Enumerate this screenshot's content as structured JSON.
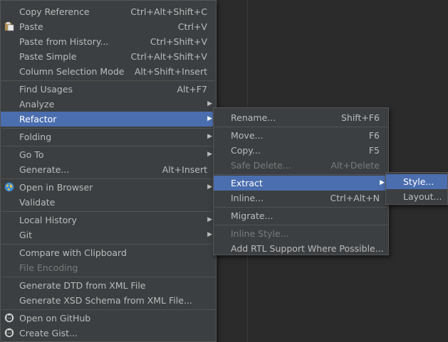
{
  "main_menu": {
    "copy_reference": {
      "label": "Copy Reference",
      "shortcut": "Ctrl+Alt+Shift+C"
    },
    "paste": {
      "label": "Paste",
      "shortcut": "Ctrl+V"
    },
    "paste_from_history": {
      "label": "Paste from History...",
      "shortcut": "Ctrl+Shift+V"
    },
    "paste_simple": {
      "label": "Paste Simple",
      "shortcut": "Ctrl+Alt+Shift+V"
    },
    "column_selection_mode": {
      "label": "Column Selection Mode",
      "shortcut": "Alt+Shift+Insert"
    },
    "find_usages": {
      "label": "Find Usages",
      "shortcut": "Alt+F7"
    },
    "analyze": {
      "label": "Analyze"
    },
    "refactor": {
      "label": "Refactor"
    },
    "folding": {
      "label": "Folding"
    },
    "go_to": {
      "label": "Go To"
    },
    "generate": {
      "label": "Generate...",
      "shortcut": "Alt+Insert"
    },
    "open_in_browser": {
      "label": "Open in Browser"
    },
    "validate": {
      "label": "Validate"
    },
    "local_history": {
      "label": "Local History"
    },
    "git": {
      "label": "Git"
    },
    "compare_with_clipboard": {
      "label": "Compare with Clipboard"
    },
    "file_encoding": {
      "label": "File Encoding"
    },
    "generate_dtd": {
      "label": "Generate DTD from XML File"
    },
    "generate_xsd": {
      "label": "Generate XSD Schema from XML File..."
    },
    "open_on_github": {
      "label": "Open on GitHub"
    },
    "create_gist": {
      "label": "Create Gist..."
    }
  },
  "refactor_menu": {
    "rename": {
      "label": "Rename...",
      "shortcut": "Shift+F6"
    },
    "move": {
      "label": "Move...",
      "shortcut": "F6"
    },
    "copy": {
      "label": "Copy...",
      "shortcut": "F5"
    },
    "safe_delete": {
      "label": "Safe Delete...",
      "shortcut": "Alt+Delete"
    },
    "extract": {
      "label": "Extract"
    },
    "inline": {
      "label": "Inline...",
      "shortcut": "Ctrl+Alt+N"
    },
    "migrate": {
      "label": "Migrate..."
    },
    "inline_style": {
      "label": "Inline Style..."
    },
    "add_rtl": {
      "label": "Add RTL Support Where Possible..."
    }
  },
  "extract_menu": {
    "style": {
      "label": "Style..."
    },
    "layout": {
      "label": "Layout..."
    }
  },
  "colors": {
    "menu_bg": "#3c3f41",
    "selection": "#4b6eaf",
    "text": "#bbbbbb",
    "disabled_text": "#7a7a7a"
  },
  "icons": {
    "paste": "clipboard-icon",
    "open_in_browser": "globe-icon",
    "open_on_github": "github-icon",
    "create_gist": "github-icon"
  }
}
